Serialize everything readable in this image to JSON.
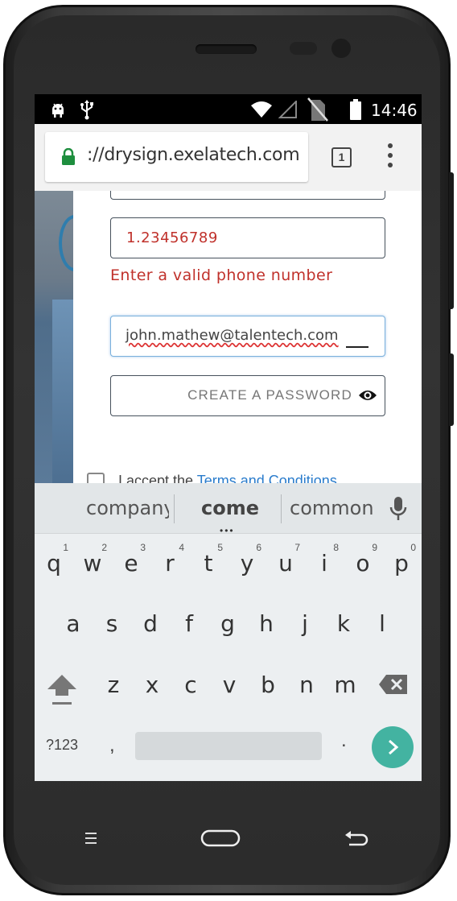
{
  "status_bar": {
    "time": "14:46",
    "icons": [
      "android-icon",
      "usb-icon",
      "wifi-icon",
      "signal-icon",
      "no-sim-icon",
      "battery-icon"
    ]
  },
  "browser": {
    "url": "://drysign.exelatech.com",
    "tab_count": "1",
    "accent": "#1e8e3e"
  },
  "form": {
    "phone_value": "1.23456789",
    "phone_error": "Enter a valid phone number",
    "email_value": "john.mathew@talentech.com",
    "password_placeholder": "CREATE A PASSWORD",
    "terms_prefix": "I accept the ",
    "terms_link": "Terms and Conditions",
    "error_color": "#c0312b"
  },
  "keyboard": {
    "suggestions": [
      "company",
      "come",
      "common"
    ],
    "row1": [
      {
        "ch": "q",
        "num": "1"
      },
      {
        "ch": "w",
        "num": "2"
      },
      {
        "ch": "e",
        "num": "3"
      },
      {
        "ch": "r",
        "num": "4"
      },
      {
        "ch": "t",
        "num": "5"
      },
      {
        "ch": "y",
        "num": "6"
      },
      {
        "ch": "u",
        "num": "7"
      },
      {
        "ch": "i",
        "num": "8"
      },
      {
        "ch": "o",
        "num": "9"
      },
      {
        "ch": "p",
        "num": "0"
      }
    ],
    "row2": [
      "a",
      "s",
      "d",
      "f",
      "g",
      "h",
      "j",
      "k",
      "l"
    ],
    "row3": [
      "z",
      "x",
      "c",
      "v",
      "b",
      "n",
      "m"
    ],
    "symbols_label": "?123",
    "comma": ",",
    "period": ".",
    "go_color": "#43b3a1"
  },
  "nav_bar": {
    "icons": [
      "recent-apps-icon",
      "home-icon",
      "back-icon"
    ]
  }
}
